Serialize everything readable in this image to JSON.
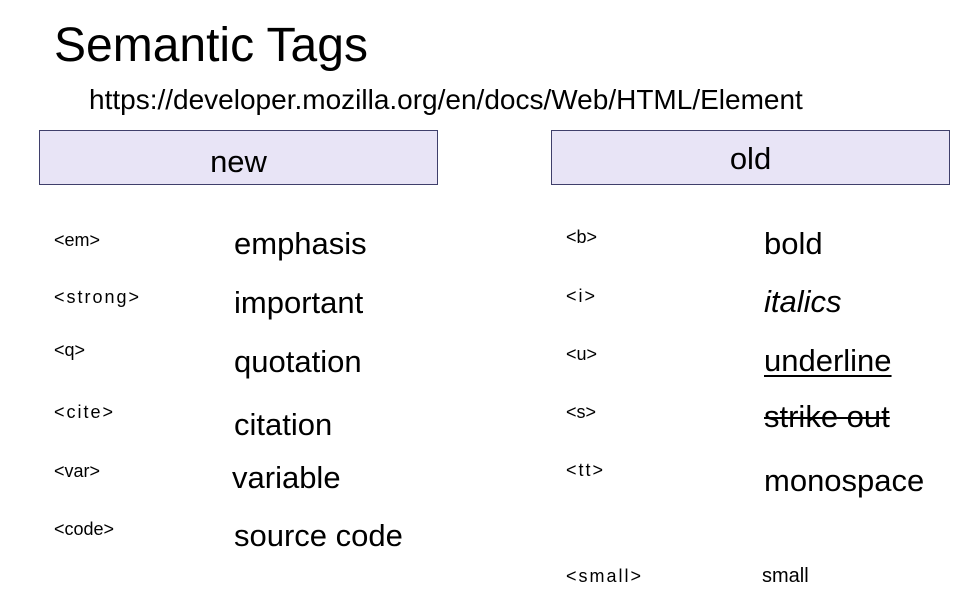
{
  "title": "Semantic Tags",
  "url": "https://developer.mozilla.org/en/docs/Web/HTML/Element",
  "columns": {
    "new": {
      "header": "new",
      "rows": [
        {
          "tag": "<em>",
          "desc": "emphasis"
        },
        {
          "tag": "<strong>",
          "desc": "important"
        },
        {
          "tag": "<q>",
          "desc": "quotation"
        },
        {
          "tag": "<cite>",
          "desc": "citation"
        },
        {
          "tag": "<var>",
          "desc": "variable"
        },
        {
          "tag": "<code>",
          "desc": "source code"
        }
      ]
    },
    "old": {
      "header": "old",
      "rows": [
        {
          "tag": "<b>",
          "desc": "bold"
        },
        {
          "tag": "<i>",
          "desc": "italics"
        },
        {
          "tag": "<u>",
          "desc": "underline"
        },
        {
          "tag": "<s>",
          "desc": "strike out"
        },
        {
          "tag": "<tt>",
          "desc": "monospace"
        },
        {
          "tag": "<small>",
          "desc": "small"
        }
      ]
    }
  },
  "colors": {
    "header_fill": "#e8e4f6",
    "header_border": "#3f3f6b"
  }
}
